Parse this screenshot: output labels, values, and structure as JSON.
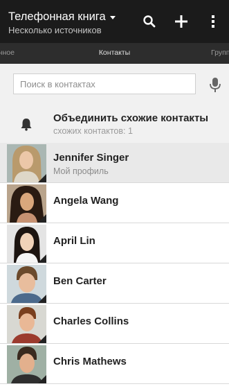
{
  "header": {
    "title": "Телефонная книга",
    "subtitle": "Несколько источников",
    "actions": [
      "search-icon",
      "plus-icon",
      "overflow-menu-icon"
    ]
  },
  "tabs": {
    "left": "ранное",
    "current": "Контакты",
    "right": "Групп"
  },
  "search": {
    "placeholder": "Поиск в контактах",
    "voice_icon": "microphone-icon"
  },
  "merge": {
    "title": "Объединить схожие контакты",
    "subtitle": "схожих контактов: 1",
    "icon": "bell-icon"
  },
  "contacts": [
    {
      "name": "Jennifer Singer",
      "subtitle": "Мой профиль"
    },
    {
      "name": "Angela Wang"
    },
    {
      "name": "April Lin"
    },
    {
      "name": "Ben Carter"
    },
    {
      "name": "Charles Collins"
    },
    {
      "name": "Chris Mathews"
    }
  ],
  "colors": {
    "appbar": "#1b1b1b",
    "tabbar": "#2d2d2d",
    "panel": "#f1f1f1",
    "profile_row": "#e9e9e9",
    "text": "#222222",
    "muted": "#8a8a8a"
  }
}
